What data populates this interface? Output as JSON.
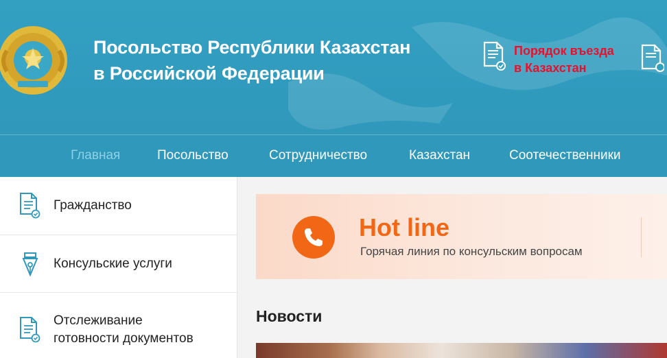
{
  "header": {
    "title_line1": "Посольство Республики Казахстан",
    "title_line2": "в Российской Федерации",
    "entry_line1": "Порядок въезда",
    "entry_line2": "в Казахстан",
    "entry_color": "#e8112d"
  },
  "nav": {
    "items": [
      "Главная",
      "Посольство",
      "Сотрудничество",
      "Казахстан",
      "Соотечественники"
    ],
    "active_index": 0
  },
  "sidebar": {
    "items": [
      {
        "line1": "Гражданство",
        "line2": "",
        "icon": "document-check-icon"
      },
      {
        "line1": "Консульские услуги",
        "line2": "",
        "icon": "pen-nib-icon"
      },
      {
        "line1": "Отслеживание",
        "line2": "готовности документов",
        "icon": "document-check-icon"
      }
    ]
  },
  "hotline": {
    "title": "Hot line",
    "subtitle": "Горячая линия по консульским вопросам",
    "accent": "#f26716"
  },
  "news": {
    "title": "Новости"
  },
  "colors": {
    "header_bg": "#33a0c2",
    "nav_active": "#8fd0e6",
    "icon_teal": "#2f98bb"
  }
}
